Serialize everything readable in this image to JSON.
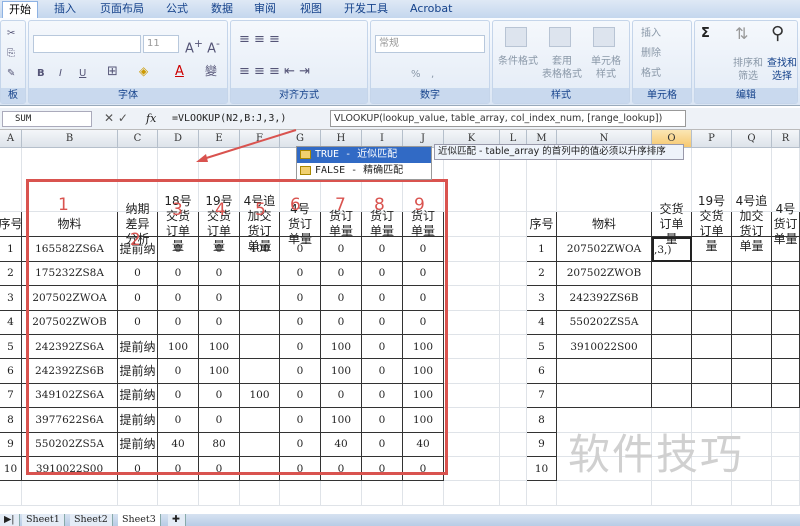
{
  "ribbon": {
    "tabs": [
      "开始",
      "插入",
      "页面布局",
      "公式",
      "数据",
      "审阅",
      "视图",
      "开发工具",
      "Acrobat"
    ],
    "active_tab": "开始",
    "groups": {
      "clipboard": "板",
      "font": "字体",
      "align": "对齐方式",
      "number": "数字",
      "styles": "样式",
      "cells": "单元格",
      "edit": "编辑"
    },
    "font_size": "11",
    "number_format": "常规",
    "percent": "%",
    "comma": ",",
    "styles_buttons": [
      "条件格式",
      "套用\n表格格式",
      "单元格\n样式"
    ],
    "cell_buttons": [
      "插入",
      "删除",
      "格式"
    ],
    "edit_buttons": [
      "排序和\n筛选",
      "查找和\n选择"
    ],
    "sigma": "Σ",
    "font_bold": "B",
    "font_italic": "I",
    "font_underline": "U"
  },
  "formula_bar": {
    "name_box": "SUM",
    "formula": "=VLOOKUP(N2,B:J,3,)",
    "fx": "fx",
    "tooltip": "VLOOKUP(lookup_value, table_array, col_index_num, [range_lookup])"
  },
  "autocomplete": {
    "items": [
      "TRUE - 近似匹配",
      "FALSE - 精确匹配"
    ],
    "selected": 0,
    "hint": "近似匹配 - table_array 的首列中的值必须以升序排序"
  },
  "columns": [
    "A",
    "B",
    "C",
    "D",
    "E",
    "F",
    "G",
    "H",
    "I",
    "J",
    "K",
    "L",
    "M",
    "N",
    "O",
    "P",
    "Q",
    "R"
  ],
  "selected_column": "O",
  "left_table": {
    "headers": [
      "序号",
      "物料",
      "纳期\n差异\n分析",
      "18号\n交货\n订单\n量",
      "19号\n交货\n订单\n量",
      "4号追\n加交\n货订\n单量",
      "4号\n货订\n单量",
      "货订\n单量",
      "货订\n单量",
      "货订\n单量"
    ],
    "rows": [
      [
        "1",
        "165582ZS6A",
        "提前纳",
        "0",
        "0",
        "400",
        "0",
        "0",
        "0",
        "0"
      ],
      [
        "2",
        "175232ZS8A",
        "0",
        "0",
        "0",
        "",
        "0",
        "0",
        "0",
        "0"
      ],
      [
        "3",
        "207502ZWOA",
        "0",
        "0",
        "0",
        "",
        "0",
        "0",
        "0",
        "0"
      ],
      [
        "4",
        "207502ZWOB",
        "0",
        "0",
        "0",
        "",
        "0",
        "0",
        "0",
        "0"
      ],
      [
        "5",
        "242392ZS6A",
        "提前纳",
        "100",
        "100",
        "",
        "0",
        "100",
        "0",
        "100"
      ],
      [
        "6",
        "242392ZS6B",
        "提前纳",
        "0",
        "100",
        "",
        "0",
        "100",
        "0",
        "100"
      ],
      [
        "7",
        "349102ZS6A",
        "提前纳",
        "0",
        "0",
        "100",
        "0",
        "0",
        "0",
        "100"
      ],
      [
        "8",
        "3977622S6A",
        "提前纳",
        "0",
        "0",
        "",
        "0",
        "100",
        "0",
        "100"
      ],
      [
        "9",
        "550202ZS5A",
        "提前纳",
        "40",
        "80",
        "",
        "0",
        "40",
        "0",
        "40"
      ],
      [
        "10",
        "3910022S00",
        "0",
        "0",
        "0",
        "",
        "0",
        "0",
        "0",
        "0"
      ]
    ]
  },
  "annotations": [
    "1",
    "2",
    "3",
    "4",
    "5",
    "6",
    "7",
    "8",
    "9"
  ],
  "right_table": {
    "headers": [
      "序号",
      "物料",
      "交货\n订单\n量",
      "19号\n交货\n订单\n量",
      "4号追\n加交\n货订\n单量",
      "4号\n货订\n单量"
    ],
    "rows": [
      [
        "1",
        "207502ZWOA",
        ",3,)"
      ],
      [
        "2",
        "207502ZWOB",
        ""
      ],
      [
        "3",
        "242392ZS6B",
        ""
      ],
      [
        "4",
        "550202ZS5A",
        ""
      ],
      [
        "5",
        "3910022S00",
        ""
      ],
      [
        "6",
        ""
      ],
      [
        "7",
        ""
      ],
      [
        "8"
      ],
      [
        "9"
      ],
      [
        "10"
      ]
    ]
  },
  "sheets": [
    "Sheet1",
    "Sheet2",
    "Sheet3"
  ],
  "active_sheet": "Sheet3",
  "watermark": "软件技巧",
  "colors": {
    "annotation": "#d9534f",
    "ribbon": "#dbe6f4",
    "selection": "#316ac5"
  }
}
